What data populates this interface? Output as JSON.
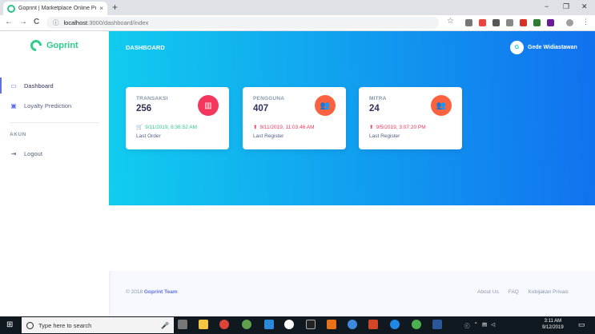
{
  "browser": {
    "tab_title": "Goprint | Marketplace Online Pri",
    "tab_close": "×",
    "new_tab": "+",
    "window_controls": [
      "−",
      "❐",
      "✕"
    ],
    "nav": [
      "←",
      "→",
      "C"
    ],
    "url_host": "localhost",
    "url_path": ":3000/dashboard/index",
    "star": "☆"
  },
  "sidebar": {
    "brand": "Goprint",
    "items": [
      {
        "label": "Dashboard",
        "icon": "monitor-icon",
        "glyph": "▭"
      },
      {
        "label": "Loyalty Prediction",
        "icon": "bag-icon",
        "glyph": "▣"
      }
    ],
    "section_heading": "AKUN",
    "account_items": [
      {
        "label": "Logout",
        "icon": "logout-icon",
        "glyph": "⇥"
      }
    ]
  },
  "header": {
    "title": "DASHBOARD",
    "user_initial": "G",
    "user_name": "Gede Widiastawan"
  },
  "cards": [
    {
      "label": "TRANSAKSI",
      "value": "256",
      "icon": "chart-icon",
      "glyph": "▥",
      "icon_color": "#f5365c",
      "stat_glyph": "🛒",
      "stat": "9/11/2019, 8:36:52 AM",
      "stat_color": "#2dce89",
      "sub": "Last Order"
    },
    {
      "label": "PENGGUNA",
      "value": "407",
      "icon": "users-icon",
      "glyph": "👥",
      "icon_color": "#fb6340",
      "stat_glyph": "⬆",
      "stat": "9/11/2019, 11:03:46 AM",
      "stat_color": "#f5365c",
      "sub": "Last Register"
    },
    {
      "label": "MITRA",
      "value": "24",
      "icon": "users-icon",
      "glyph": "👥",
      "icon_color": "#fb6340",
      "stat_glyph": "⬆",
      "stat": "9/5/2019, 3:07:20 PM",
      "stat_color": "#f5365c",
      "sub": "Last Register"
    }
  ],
  "footer": {
    "copyright": "© 2018",
    "brand": "Goprint Team",
    "links": [
      "About Us",
      "FAQ",
      "Kebijakan Privasi"
    ]
  },
  "taskbar": {
    "search_placeholder": "Type here to search",
    "time": "3:11 AM",
    "date": "9/12/2019"
  },
  "colors": {
    "accent": "#5e72e4",
    "brand_green": "#2dce89",
    "header_gradient_start": "#11cdef",
    "header_gradient_end": "#1171ef"
  }
}
